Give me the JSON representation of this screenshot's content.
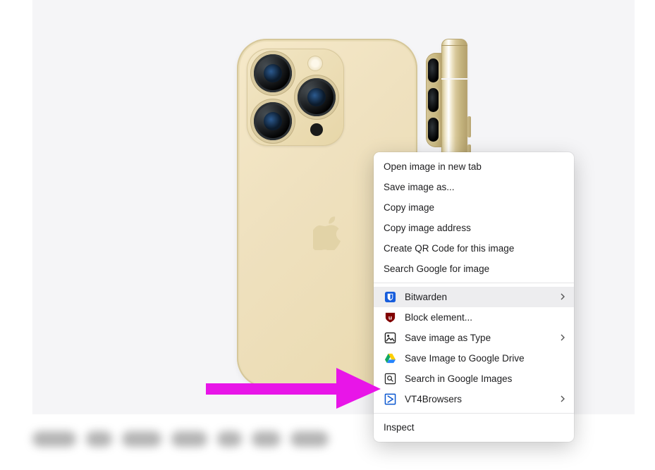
{
  "context_menu": {
    "group1": [
      "Open image in new tab",
      "Save image as...",
      "Copy image",
      "Copy image address",
      "Create QR Code for this image",
      "Search Google for image"
    ],
    "group2": [
      {
        "icon": "bitwarden",
        "label": "Bitwarden",
        "submenu": true,
        "hover": true
      },
      {
        "icon": "ublock",
        "label": "Block element...",
        "submenu": false
      },
      {
        "icon": "imagetype",
        "label": "Save image as Type",
        "submenu": true
      },
      {
        "icon": "gdrive",
        "label": "Save Image to Google Drive",
        "submenu": false
      },
      {
        "icon": "gimages",
        "label": "Search in Google Images",
        "submenu": false
      },
      {
        "icon": "vt4b",
        "label": "VT4Browsers",
        "submenu": true
      }
    ],
    "group3": [
      "Inspect"
    ]
  }
}
